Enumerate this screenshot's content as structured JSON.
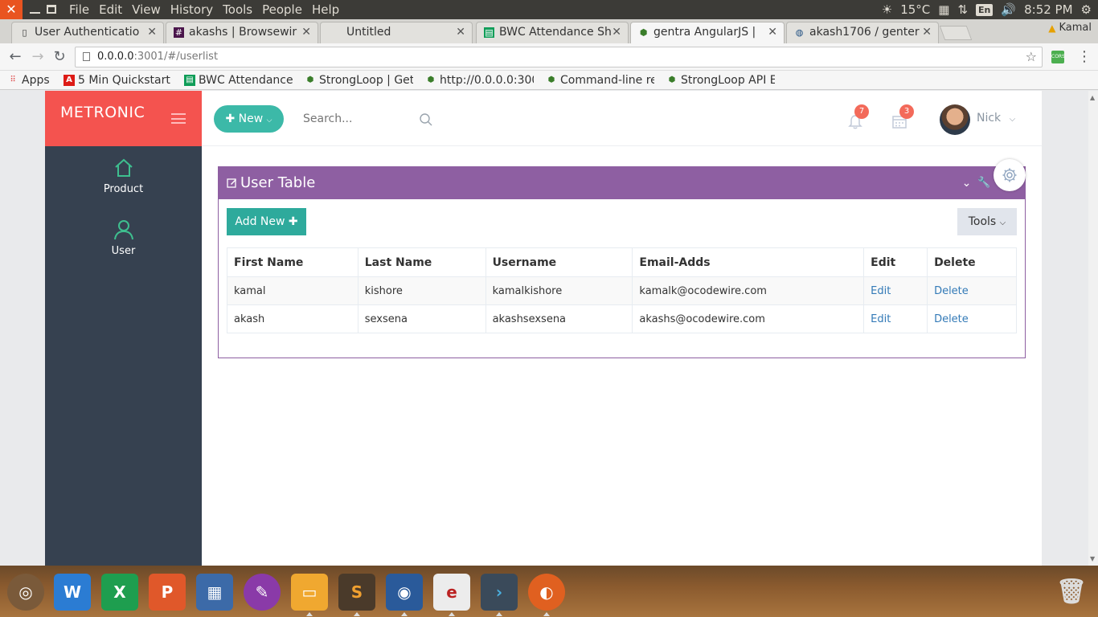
{
  "os": {
    "menus": [
      "File",
      "Edit",
      "View",
      "History",
      "Tools",
      "People",
      "Help"
    ],
    "weather": "15°C",
    "keyboard": "En",
    "time": "8:52 PM"
  },
  "browser": {
    "tabs": [
      {
        "title": "User Authenticatio",
        "icon": "page-icon"
      },
      {
        "title": "akashs | Browsewir",
        "icon": "slack-icon"
      },
      {
        "title": "Untitled",
        "icon": "none"
      },
      {
        "title": "BWC Attendance Sh",
        "icon": "sheets-icon"
      },
      {
        "title": "gentra AngularJS |",
        "icon": "strongloop-icon"
      },
      {
        "title": "akash1706 / genter",
        "icon": "bitbucket-icon"
      }
    ],
    "profile": "Kamal",
    "url_host": "0.0.0.0",
    "url_rest": ":3001/#/userlist",
    "ext_label": "CORS",
    "bookmarks": [
      {
        "label": "Apps",
        "icon": "apps-grid-icon"
      },
      {
        "label": "5 Min Quickstart",
        "icon": "angular-icon"
      },
      {
        "label": "BWC Attendance",
        "icon": "sheets-icon"
      },
      {
        "label": "StrongLoop | Get",
        "icon": "strongloop-icon"
      },
      {
        "label": "http://0.0.0.0:300",
        "icon": "strongloop-icon"
      },
      {
        "label": "Command-line re",
        "icon": "strongloop-icon"
      },
      {
        "label": "StrongLoop API E",
        "icon": "strongloop-icon"
      }
    ]
  },
  "app": {
    "brand": "METRONIC",
    "sidebar": [
      {
        "label": "Product",
        "icon": "home-icon"
      },
      {
        "label": "User",
        "icon": "user-icon"
      }
    ],
    "header": {
      "new_label": "New",
      "search_placeholder": "Search...",
      "notifications_count": "7",
      "tasks_count": "3",
      "user_name": "Nick"
    },
    "portlet": {
      "title": "User Table",
      "add_label": "Add New",
      "tools_label": "Tools"
    },
    "table": {
      "columns": [
        "First Name",
        "Last Name",
        "Username",
        "Email-Adds",
        "Edit",
        "Delete"
      ],
      "rows": [
        {
          "first": "kamal",
          "last": "kishore",
          "username": "kamalkishore",
          "email": "kamalk@ocodewire.com",
          "edit": "Edit",
          "delete": "Delete"
        },
        {
          "first": "akash",
          "last": "sexsena",
          "username": "akashsexsena",
          "email": "akashs@ocodewire.com",
          "edit": "Edit",
          "delete": "Delete"
        }
      ]
    }
  },
  "colors": {
    "brand_red": "#f4534f",
    "sidebar_dark": "#364150",
    "portlet_purple": "#8e5fa2",
    "teal": "#2eaa9c",
    "link_blue": "#337ab7"
  }
}
